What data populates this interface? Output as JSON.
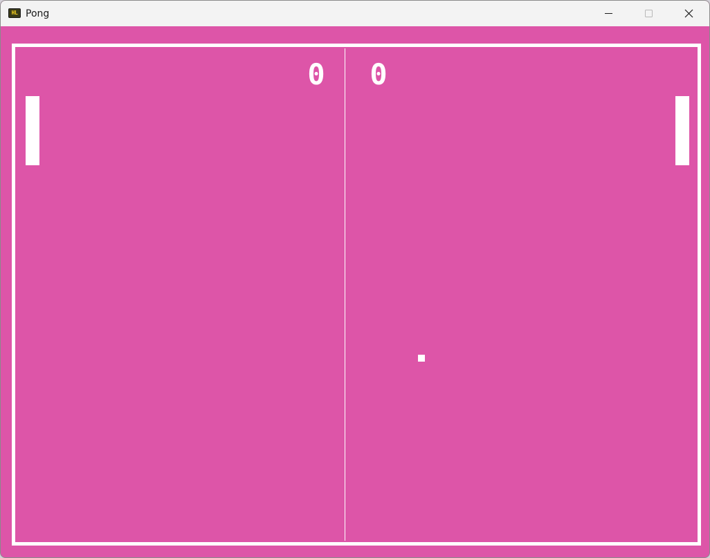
{
  "window": {
    "title": "Pong",
    "icon": "hl-app-icon",
    "icon_text": "HL",
    "controls": [
      "minimize-icon",
      "maximize-icon",
      "close-icon"
    ]
  },
  "game": {
    "background_color": "#dd55a8",
    "foreground_color": "#ffffff",
    "score_left": "0",
    "score_right": "0"
  }
}
